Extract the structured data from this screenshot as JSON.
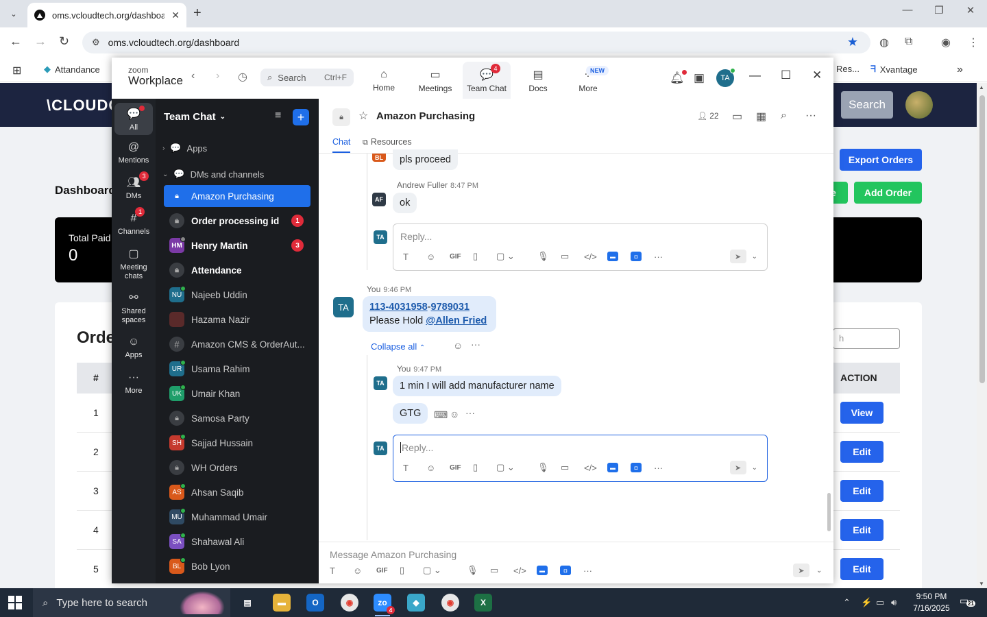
{
  "browser": {
    "tab_title": "oms.vcloudtech.org/dashboard",
    "url": "oms.vcloudtech.org/dashboard",
    "bookmarks": {
      "apps_icon": "apps-grid-icon",
      "attendance": "Attandance",
      "res": "Res...",
      "xvantage": "Xvantage"
    }
  },
  "page": {
    "logo": "\\CLOUDCI",
    "search_button": "Search",
    "dashboard_title": "Dashboard",
    "export_orders": "Export Orders",
    "green_button_partial": "e",
    "add_order": "Add Order",
    "total_paid_label": "Total Paid",
    "total_paid_value": "0",
    "orders_title": "Orde",
    "orders_search_placeholder": "h",
    "table_header_hash": "#",
    "table_header_action": "ACTION",
    "rows": [
      {
        "num": "1",
        "action": "View"
      },
      {
        "num": "2",
        "action": "Edit"
      },
      {
        "num": "3",
        "action": "Edit"
      },
      {
        "num": "4",
        "action": "Edit"
      },
      {
        "num": "5",
        "action": "Edit"
      }
    ]
  },
  "zoom": {
    "logo_top": "zoom",
    "logo_bottom": "Workplace",
    "search_label": "Search",
    "search_shortcut": "Ctrl+F",
    "tabs": [
      {
        "label": "Home",
        "icon": "home-icon"
      },
      {
        "label": "Meetings",
        "icon": "video-icon"
      },
      {
        "label": "Team Chat",
        "icon": "chat-icon",
        "badge": "4"
      },
      {
        "label": "Docs",
        "icon": "docs-icon"
      },
      {
        "label": "More",
        "icon": "more-icon",
        "pill": "NEW"
      }
    ],
    "user_initials": "TA",
    "rail": [
      {
        "label": "All",
        "icon": "chat-bubble-icon"
      },
      {
        "label": "Mentions",
        "icon": "at-icon"
      },
      {
        "label": "DMs",
        "icon": "people-icon",
        "badge": "3"
      },
      {
        "label": "Channels",
        "icon": "hash-icon",
        "badge": "1"
      },
      {
        "label": "Meeting chats",
        "icon": "calendar-icon"
      },
      {
        "label": "Shared spaces",
        "icon": "shared-icon"
      },
      {
        "label": "Apps",
        "icon": "apps-icon"
      },
      {
        "label": "More",
        "icon": "ellipsis-icon"
      }
    ],
    "list_title": "Team Chat",
    "section_apps": "Apps",
    "section_dms": "DMs and channels",
    "channels": [
      {
        "name": "Amazon Purchasing",
        "type": "lock",
        "active": true
      },
      {
        "name": "Order processing id",
        "type": "lock",
        "bold": true,
        "count": "1"
      },
      {
        "name": "Henry Martin",
        "type": "avatar",
        "initials": "HM",
        "color": "#7b3aa6",
        "bold": true,
        "count": "3",
        "status": "off"
      },
      {
        "name": "Attendance",
        "type": "lock",
        "bold": true
      },
      {
        "name": "Najeeb Uddin",
        "type": "avatar",
        "initials": "NU",
        "color": "#1f6e8c",
        "status": "on"
      },
      {
        "name": "Hazama Nazir",
        "type": "avatar",
        "initials": "",
        "color": "#5a2a2a"
      },
      {
        "name": "Amazon CMS & OrderAut...",
        "type": "hash"
      },
      {
        "name": "Usama Rahim",
        "type": "avatar",
        "initials": "UR",
        "color": "#1f6e8c",
        "status": "on"
      },
      {
        "name": "Umair Khan",
        "type": "avatar",
        "initials": "UK",
        "color": "#1f9e6a",
        "status": "on"
      },
      {
        "name": "Samosa Party",
        "type": "lock"
      },
      {
        "name": "Sajjad Hussain",
        "type": "avatar",
        "initials": "SH",
        "color": "#c53a2e",
        "status": "on"
      },
      {
        "name": "WH Orders",
        "type": "lock"
      },
      {
        "name": "Ahsan Saqib",
        "type": "avatar",
        "initials": "AS",
        "color": "#d9591b",
        "status": "on"
      },
      {
        "name": "Muhammad Umair",
        "type": "avatar",
        "initials": "MU",
        "color": "#2f4a63",
        "status": "on"
      },
      {
        "name": "Shahawal Ali",
        "type": "avatar",
        "initials": "SA",
        "color": "#7a4fc0",
        "status": "on"
      },
      {
        "name": "Bob Lyon",
        "type": "avatar",
        "initials": "BL",
        "color": "#d9591b",
        "status": "on"
      }
    ],
    "chat": {
      "title": "Amazon Purchasing",
      "members": "22",
      "tab_chat": "Chat",
      "tab_resources": "Resources",
      "msg_partial": "pls proceed",
      "partial_avatar": "BL",
      "af_name": "Andrew Fuller",
      "af_time": "8:47 PM",
      "af_initials": "AF",
      "af_text": "ok",
      "reply_placeholder": "Reply...",
      "me_initials": "TA",
      "main_author": "You",
      "main_time": "9:46 PM",
      "main_link1": "113-4031958",
      "main_dash": "-",
      "main_link2": "9789031",
      "main_text": "Please Hold ",
      "main_mention": "@Allen Fried",
      "collapse_all": "Collapse all",
      "r_author": "You",
      "r_time": "9:47 PM",
      "r_text1": "1 min I will add manufacturer name",
      "r_text2": "GTG",
      "composer_placeholder": "Message Amazon Purchasing"
    }
  },
  "taskbar": {
    "search_placeholder": "Type here to search",
    "time": "9:50 PM",
    "date": "7/16/2025",
    "notification_count": "21",
    "zoom_badge": "4"
  }
}
